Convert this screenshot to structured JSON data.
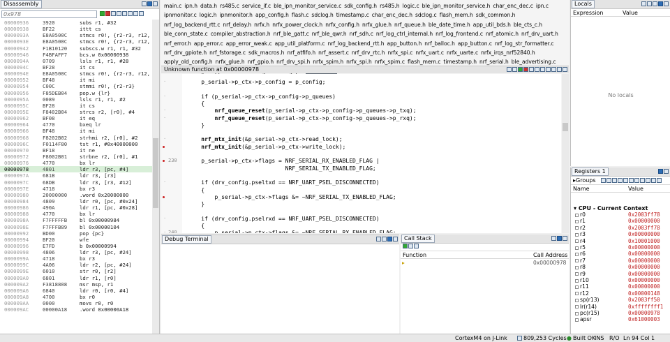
{
  "disassembly": {
    "title": "Disassembly",
    "input_placeholder": "0x978",
    "rows": [
      [
        "00000936",
        "3920",
        "subs r1, #32"
      ],
      [
        "00000938",
        "BF22",
        "ittt cs"
      ],
      [
        "0000093A",
        "E8A0500C",
        "stmcs r0!, {r2-r3, r12,"
      ],
      [
        "0000093E",
        "E8A0500C",
        "stmcs r0!, {r2-r3, r12,"
      ],
      [
        "00000942",
        "F1B10120",
        "subscs.w r1, r1, #32"
      ],
      [
        "00000946",
        "F4BFAFF7",
        "bcs.w 0x00000938"
      ],
      [
        "0000094A",
        "0709",
        "lsls r1, r1, #28"
      ],
      [
        "0000094C",
        "BF28",
        "it cs"
      ],
      [
        "0000094E",
        "E8A0500C",
        "stmcs r0!, {r2-r3, r12,"
      ],
      [
        "00000952",
        "BF48",
        "it mi"
      ],
      [
        "00000954",
        "C00C",
        "stmmi r0!, {r2-r3}"
      ],
      [
        "00000956",
        "F85DEB04",
        "pop.w {lr}"
      ],
      [
        "0000095A",
        "0089",
        "lsls r1, r1, #2"
      ],
      [
        "0000095C",
        "BF28",
        "it cs"
      ],
      [
        "0000095E",
        "F8402B04",
        "strcs r2, [r0], #4"
      ],
      [
        "00000962",
        "BF08",
        "it eq"
      ],
      [
        "00000964",
        "4770",
        "bxeq lr"
      ],
      [
        "00000966",
        "BF48",
        "it mi"
      ],
      [
        "00000968",
        "F8202B02",
        "strhmi r2, [r0], #2"
      ],
      [
        "0000096C",
        "F0114F80",
        "tst r1, #0x40000000"
      ],
      [
        "00000970",
        "BF18",
        "it ne"
      ],
      [
        "00000972",
        "F8002B01",
        "strbne r2, [r0], #1"
      ],
      [
        "00000976",
        "4770",
        "bx lr"
      ],
      [
        "00000978",
        "4801",
        "ldr r3, [pc, #4]"
      ],
      [
        "0000097A",
        "681B",
        "ldr r3, [r3]"
      ],
      [
        "0000097C",
        "68DB",
        "ldr r3, [r3, #12]"
      ],
      [
        "0000097E",
        "4718",
        "bx r3"
      ],
      [
        "00000980",
        "20000000",
        ".word 0x20000000"
      ],
      [
        "00000984",
        "4809",
        "ldr r0, [pc, #0x24]"
      ],
      [
        "00000986",
        "490A",
        "ldr r1, [pc, #0x28]"
      ],
      [
        "00000988",
        "4770",
        "bx lr"
      ],
      [
        "0000098A",
        "F7FFFFFB",
        "bl 0x00000984"
      ],
      [
        "0000098E",
        "F7FFFB89",
        "bl 0x00000104"
      ],
      [
        "00000992",
        "BD00",
        "pop {pc}"
      ],
      [
        "00000994",
        "BF20",
        "wfe"
      ],
      [
        "00000996",
        "E7FD",
        "b 0x00000994"
      ],
      [
        "00000998",
        "4806",
        "ldr r3, [pc, #24]"
      ],
      [
        "0000099A",
        "4718",
        "bx r3"
      ],
      [
        "0000099C",
        "4A06",
        "ldr r2, [pc, #24]"
      ],
      [
        "0000099E",
        "6010",
        "str r0, [r2]"
      ],
      [
        "000009A0",
        "6801",
        "ldr r1, [r0]"
      ],
      [
        "000009A2",
        "F3818808",
        "msr msp, r1"
      ],
      [
        "000009A6",
        "6840",
        "ldr r0, [r0, #4]"
      ],
      [
        "000009A8",
        "4700",
        "bx r0"
      ],
      [
        "000009AA",
        "0000",
        "movs r0, r0"
      ],
      [
        "000009AC",
        "00000A18",
        ".word 0x00000A18"
      ]
    ]
  },
  "editor": {
    "file_tabs": [
      "main.c",
      "ipn.h",
      "data.h",
      "rs485.c",
      "service_if.c",
      "ble_ipn_monitor_service.c",
      "sdk_config.h",
      "rs485.h",
      "logic.c",
      "ble_ipn_monitor_service.h",
      "char_enc_dec.c",
      "ipn.c",
      "ipnmonitor.c",
      "logic.h",
      "ipnmonitor.h",
      "app_config.h",
      "flash.c",
      "sdclog.h",
      "timestamp.c",
      "char_enc_dec.h",
      "sdclog.c",
      "flash_mem.h",
      "sdk_common.h",
      "nrf_log_backend_rtt.c",
      "nrf_delay.h",
      "nrfx.h",
      "nrfx_power_clock.h",
      "nrfx_config.h",
      "nrfx_glue.h",
      "nrf_queue.h",
      "ble_date_time.h",
      "app_util_bds.h",
      "ble_cts_c.h",
      "ble_conn_state.c",
      "compiler_abstraction.h",
      "nrf_ble_gatt.c",
      "nrf_ble_qwr.h",
      "nrf_sdh.c",
      "nrf_log_ctrl_internal.h",
      "nrf_log_frontend.c",
      "nrf_atomic.h",
      "nrf_drv_uart.h",
      "nrf_error.h",
      "app_error.c",
      "app_error_weak.c",
      "app_util_platform.c",
      "nrf_log_backend_rtt.h",
      "app_button.h",
      "nrf_balloc.h",
      "app_button.c",
      "nrf_log_str_formatter.c",
      "nrf_drv_gpiote.h",
      "nrf_fstorage.c",
      "sdk_macros.h",
      "nrf_atfifo.h",
      "nrf_assert.c",
      "nrf_drv_rtc.h",
      "nrfx_spi.c",
      "nrfx_uart.c",
      "nrfx_uarte.c",
      "nrfx_irqs_nrf52840.h",
      "apply_old_config.h",
      "nrfx_glue.h",
      "nrf_gpio.h",
      "nrf_drv_spi.h",
      "nrfx_spim.h",
      "nrfx_spi.h",
      "nrfx_spim.c",
      "flash_mem.c",
      "timestamp.h",
      "nrf_serial.h",
      "ble_advertising.c",
      "ble_advertising.h",
      "app_error_handler_gcc.c",
      "ble_gap.h",
      "nrf_serial.c",
      "nrf_mtx.h"
    ],
    "active_tab": "nrf_serial.c",
    "function_label": "Unknown function at 0x00000978",
    "code_lines": [
      {
        "ln": "",
        "marker": "dot",
        "text": "    p_serial->p_ctx->p_config = p_config;"
      },
      {
        "ln": "",
        "marker": "",
        "text": ""
      },
      {
        "ln": "",
        "marker": "dot",
        "text": "    if (p_serial->p_ctx->p_config->p_queues)"
      },
      {
        "ln": "",
        "marker": "",
        "text": "    {"
      },
      {
        "ln": "",
        "marker": "dot",
        "text": "        nrf_queue_reset(p_serial->p_ctx->p_config->p_queues->p_txq);",
        "bold": "nrf_queue_reset"
      },
      {
        "ln": "",
        "marker": "dot",
        "text": "        nrf_queue_reset(p_serial->p_ctx->p_config->p_queues->p_rxq);",
        "bold": "nrf_queue_reset"
      },
      {
        "ln": "",
        "marker": "",
        "text": "    }"
      },
      {
        "ln": "",
        "marker": "",
        "text": ""
      },
      {
        "ln": "",
        "marker": "dot",
        "text": "    nrf_mtx_init(&p_serial->p_ctx->read_lock);",
        "bold": "nrf_mtx_init"
      },
      {
        "ln": "",
        "marker": "bp",
        "text": "    nrf_mtx_init(&p_serial->p_ctx->write_lock);",
        "bold": "nrf_mtx_init"
      },
      {
        "ln": "",
        "marker": "",
        "text": ""
      },
      {
        "ln": "230",
        "marker": "bp",
        "text": "    p_serial->p_ctx->flags = NRF_SERIAL_RX_ENABLED_FLAG |"
      },
      {
        "ln": "",
        "marker": "",
        "text": "                             NRF_SERIAL_TX_ENABLED_FLAG;"
      },
      {
        "ln": "",
        "marker": "",
        "text": ""
      },
      {
        "ln": "",
        "marker": "dot",
        "text": "    if (drv_config.pseltxd == NRF_UART_PSEL_DISCONNECTED)"
      },
      {
        "ln": "",
        "marker": "",
        "text": "    {"
      },
      {
        "ln": "",
        "marker": "bp",
        "text": "        p_serial->p_ctx->flags &= ~NRF_SERIAL_TX_ENABLED_FLAG;"
      },
      {
        "ln": "",
        "marker": "",
        "text": "    }"
      },
      {
        "ln": "",
        "marker": "",
        "text": ""
      },
      {
        "ln": "",
        "marker": "dot",
        "text": "    if (drv_config.pselrxd == NRF_UART_PSEL_DISCONNECTED)"
      },
      {
        "ln": "",
        "marker": "",
        "text": "    {"
      },
      {
        "ln": "240",
        "marker": "dot",
        "text": "        p_serial->p_ctx->flags &= ~NRF_SERIAL_RX_ENABLED_FLAG;"
      }
    ]
  },
  "locals": {
    "title": "Locals",
    "col_expression": "Expression",
    "col_value": "Value",
    "empty_text": "No locals"
  },
  "registers": {
    "title": "Registers 1",
    "groups_label": "Groups",
    "col_name": "Name",
    "col_value": "Value",
    "group_name": "CPU - Current Context",
    "items": [
      [
        "r0",
        "0x2003ff78"
      ],
      [
        "r1",
        "0x00000000"
      ],
      [
        "r2",
        "0x2003ff78"
      ],
      [
        "r3",
        "0x00000000"
      ],
      [
        "r4",
        "0x10001000"
      ],
      [
        "r5",
        "0x00000000"
      ],
      [
        "r6",
        "0x00000000"
      ],
      [
        "r7",
        "0x00000000"
      ],
      [
        "r8",
        "0x00000000"
      ],
      [
        "r9",
        "0x00000000"
      ],
      [
        "r10",
        "0x00000000"
      ],
      [
        "r11",
        "0x00000000"
      ],
      [
        "r12",
        "0x00000148"
      ],
      [
        "sp(r13)",
        "0x2003ff50"
      ],
      [
        "lr(r14)",
        "0xffffffff1"
      ],
      [
        "pc(r15)",
        "0x00000978"
      ],
      [
        "apsr",
        "0x61000003"
      ]
    ]
  },
  "debug_terminal": {
    "title": "Debug Terminal"
  },
  "call_stack": {
    "title": "Call Stack",
    "col_function": "Function",
    "col_address": "Call Address",
    "row_address": "0x00000978"
  },
  "status": {
    "target": "CortexM4 on J-Link",
    "cycles": "809,253 Cycles",
    "build": "Built OK",
    "ins": "INS",
    "ro": "R/O",
    "pos": "Ln 94 Col 1"
  }
}
